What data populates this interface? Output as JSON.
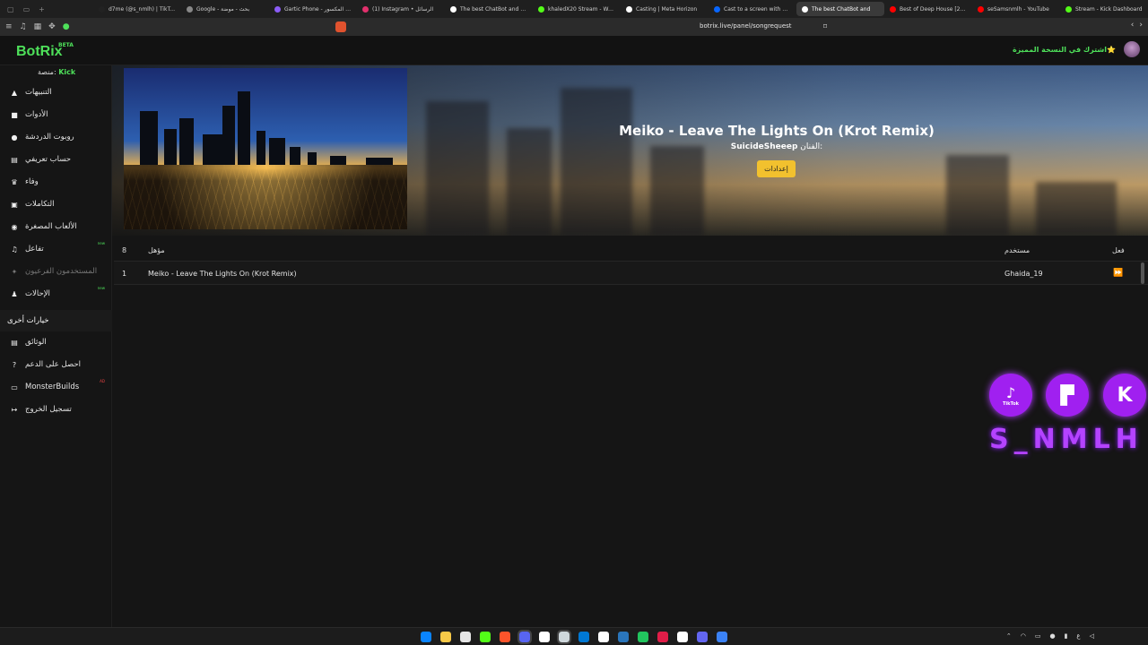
{
  "browser": {
    "tabs": [
      {
        "label": "d7me (@s_nmlh) | TikTok(5)",
        "fav": "#222"
      },
      {
        "label": "Google - بحث - موضة",
        "fav": "#888"
      },
      {
        "label": "Gartic Phone - الكاتب المكسور",
        "fav": "#8b5cf6"
      },
      {
        "label": "(1) Instagram • الرسائل",
        "fav": "#e1306c"
      },
      {
        "label": "The best ChatBot and Widg",
        "fav": "#fff"
      },
      {
        "label": "khaledX20 Stream - Watch",
        "fav": "#53fc18"
      },
      {
        "label": "Casting | Meta Horizon",
        "fav": "#fff"
      },
      {
        "label": "Cast to a screen with Meta",
        "fav": "#0866ff"
      },
      {
        "label": "The best ChatBot and",
        "fav": "#fff"
      },
      {
        "label": "Best of Deep House [2025]",
        "fav": "#ff0000"
      },
      {
        "label": "seSamsnmlh - YouTube",
        "fav": "#ff0000"
      },
      {
        "label": "Stream - Kick Dashboard",
        "fav": "#53fc18"
      }
    ],
    "url": "botrix.live/panel/songrequest"
  },
  "app": {
    "logo": "BotRix",
    "beta": "BETA",
    "premium": "اشترك في النسخة المميزة⭐",
    "platform_label": "منصة:",
    "platform_value": "Kick"
  },
  "sidebar": {
    "items": [
      {
        "label": "التنبيهات",
        "icon": "alert-triangle-icon",
        "glyph": "▲"
      },
      {
        "label": "الأدوات",
        "icon": "tools-icon",
        "glyph": "■"
      },
      {
        "label": "روبوت الدردشة",
        "icon": "robot-icon",
        "glyph": "●"
      },
      {
        "label": "حساب تعريفي",
        "icon": "id-card-icon",
        "glyph": "▤"
      },
      {
        "label": "وفاء",
        "icon": "trophy-icon",
        "glyph": "♛"
      },
      {
        "label": "التكاملات",
        "icon": "integrations-icon",
        "glyph": "▣"
      },
      {
        "label": "الألعاب المصغرة",
        "icon": "gamepad-icon",
        "glyph": "◉"
      },
      {
        "label": "تفاعل",
        "icon": "music-icon",
        "glyph": "♫",
        "badge": "new"
      },
      {
        "label": "المستخدمون الفرعيون",
        "icon": "subusers-icon",
        "glyph": "✦"
      },
      {
        "label": "الإحالات",
        "icon": "users-icon",
        "glyph": "♟",
        "badge": "new"
      }
    ],
    "section_title": "خيارات أخرى",
    "other_items": [
      {
        "label": "الوثائق",
        "icon": "docs-icon",
        "glyph": "▤"
      },
      {
        "label": "احصل على الدعم",
        "icon": "help-icon",
        "glyph": "?"
      },
      {
        "label": "MonsterBuilds",
        "icon": "monitor-icon",
        "glyph": "▭",
        "badge": "AD"
      },
      {
        "label": "تسجيل الخروج",
        "icon": "logout-icon",
        "glyph": "↦"
      }
    ]
  },
  "now_playing": {
    "title": "Meiko - Leave The Lights On (Krot Remix)",
    "artist_label": "الفنان:",
    "artist_name": "SuicideSheeep",
    "settings_label": "إعدادات"
  },
  "queue": {
    "headers": {
      "index": "8",
      "song": "مؤهل",
      "user": "مستخدم",
      "action": "فعل"
    },
    "rows": [
      {
        "index": "1",
        "song": "Meiko - Leave The Lights On (Krot Remix)",
        "user": "Ghaida_19"
      }
    ]
  },
  "overlay": {
    "icons": [
      "tiktok-icon",
      "twitch-icon",
      "kick-icon"
    ],
    "tiktok_label": "TikTok",
    "handle": "S_NMLH",
    "accent": "#a020f0"
  },
  "taskbar": {
    "apps": [
      "#0a84ff",
      "#f7c948",
      "#e5e5e5",
      "#53fc18",
      "#fb542b",
      "#5865f2",
      "#ffffff",
      "#cfd8dc",
      "#0078d4",
      "#ffffff",
      "#2a75bb",
      "#22c55e",
      "#e11d48",
      "#ffffff",
      "#6366f1",
      "#3b82f6"
    ],
    "lang": "ع"
  }
}
